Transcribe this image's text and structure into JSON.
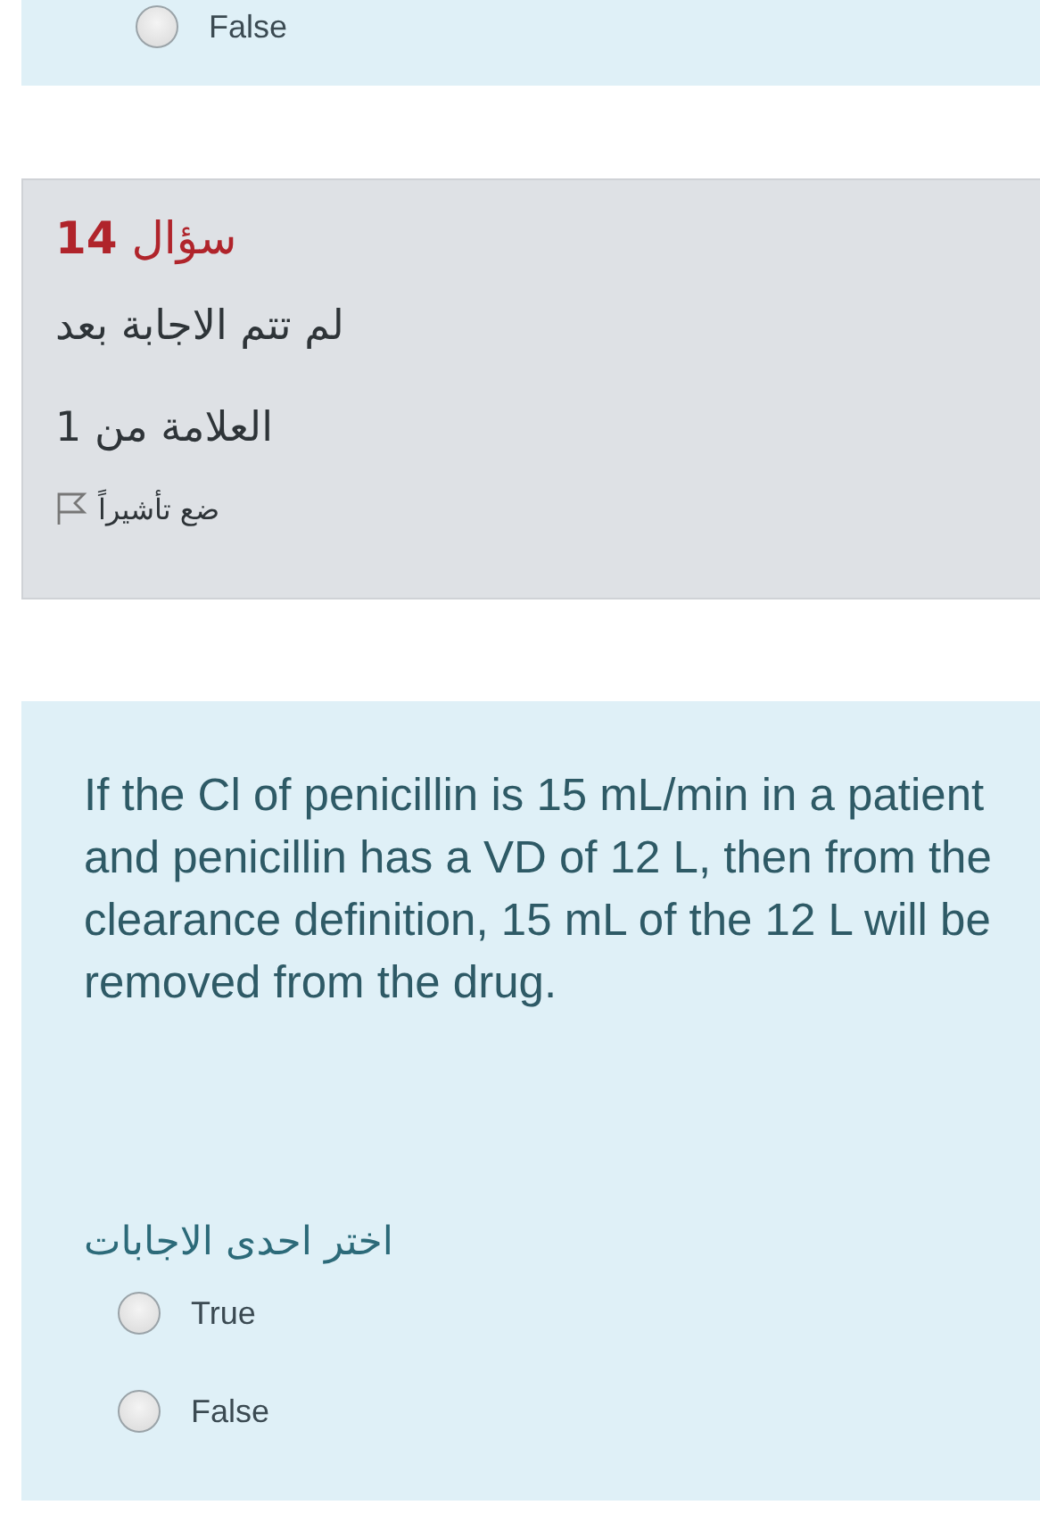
{
  "previous_question": {
    "options": [
      {
        "label": "False",
        "selected": false
      }
    ]
  },
  "question_info": {
    "title": "سؤال **14**",
    "status": "لم تتم الاجابة بعد",
    "mark": "العلامة من 1",
    "flag_label": "ضع تأشيراً",
    "flagged": false
  },
  "question": {
    "text": "If the Cl of penicillin is 15 mL/min in a patient and penicillin has a VD of 12 L, then from the clearance definition, 15 mL of the 12 L will be removed from the drug.",
    "prompt": "اختر احدى الاجابات",
    "options": [
      {
        "label": "True",
        "selected": false
      },
      {
        "label": "False",
        "selected": false
      }
    ]
  }
}
